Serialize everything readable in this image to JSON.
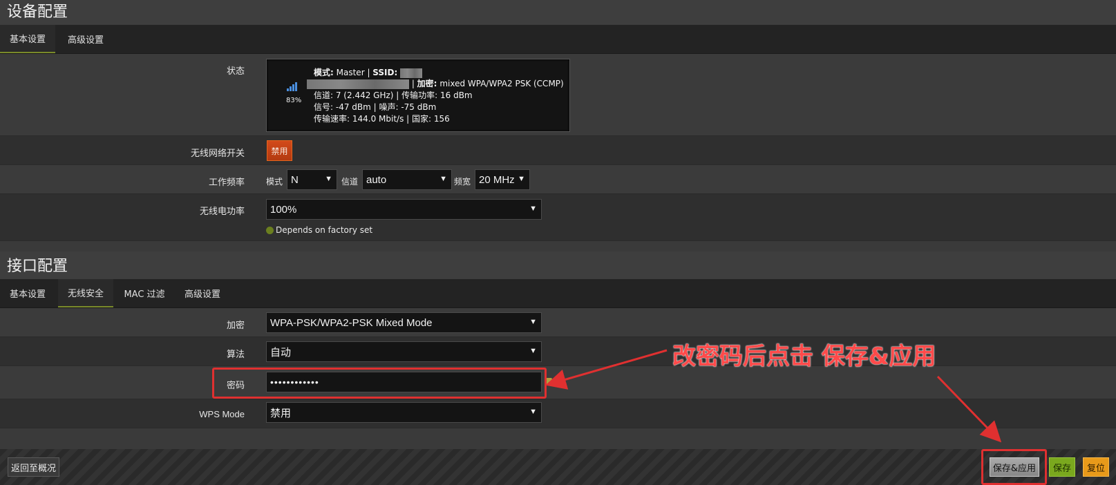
{
  "device_config": {
    "title": "设备配置",
    "tabs": [
      {
        "label": "基本设置"
      },
      {
        "label": "高级设置"
      }
    ],
    "status_label": "状态",
    "status": {
      "signal_percent": "83%",
      "line1_mode_label": "模式:",
      "line1_mode_value": "Master",
      "line1_ssid_label": "SSID:",
      "line2_encryption_label": "加密:",
      "line2_encryption_value": "mixed WPA/WPA2 PSK (CCMP)",
      "line3": "信道: 7 (2.442 GHz) | 传输功率: 16 dBm",
      "line4": "信号: -47 dBm | 噪声: -75 dBm",
      "line5": "传输速率: 144.0 Mbit/s | 国家: 156"
    },
    "wifi_switch_label": "无线网络开关",
    "wifi_switch_button": "禁用",
    "frequency_label": "工作频率",
    "mode_label": "模式",
    "mode_value": "N",
    "channel_label": "信道",
    "channel_value": "auto",
    "bandwidth_label": "频宽",
    "bandwidth_value": "20 MHz",
    "power_label": "无线电功率",
    "power_value": "100%",
    "power_hint": "Depends on factory set"
  },
  "interface_config": {
    "title": "接口配置",
    "tabs": [
      {
        "label": "基本设置"
      },
      {
        "label": "无线安全"
      },
      {
        "label": "MAC 过滤"
      },
      {
        "label": "高级设置"
      }
    ],
    "encryption_label": "加密",
    "encryption_value": "WPA-PSK/WPA2-PSK Mixed Mode",
    "algorithm_label": "算法",
    "algorithm_value": "自动",
    "password_label": "密码",
    "password_value": "••••••••••••",
    "wps_label": "WPS Mode",
    "wps_value": "禁用"
  },
  "annotation": {
    "text": "改密码后点击 保存&应用"
  },
  "footer": {
    "back_button": "返回至概况",
    "save_apply_button": "保存&应用",
    "save_button": "保存",
    "reset_button": "复位"
  },
  "colors": {
    "accent_olive": "#7a8a2a",
    "danger": "#d24a1a",
    "annotation_red": "#e03030"
  }
}
